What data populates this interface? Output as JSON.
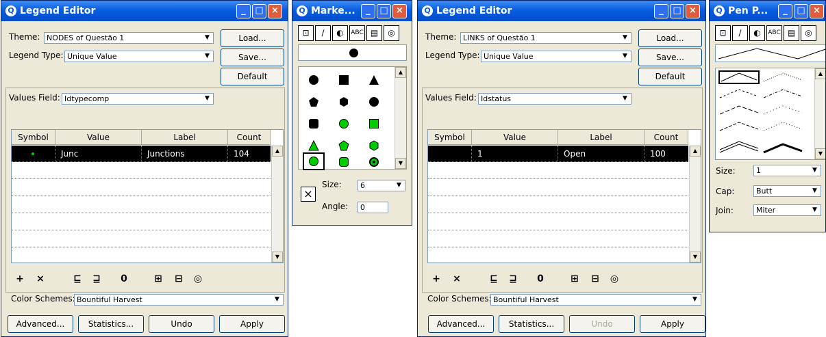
{
  "editor1": {
    "title": "Legend Editor",
    "theme_label": "Theme:",
    "theme_value": "NODES of Questão 1",
    "legend_type_label": "Legend Type:",
    "legend_type_value": "Unique Value",
    "values_field_label": "Values Field:",
    "values_field_value": "Idtypecomp",
    "btn_load": "Load...",
    "btn_save": "Save...",
    "btn_default": "Default",
    "columns": [
      "Symbol",
      "Value",
      "Label",
      "Count"
    ],
    "rows": [
      {
        "value": "Junc",
        "label": "Junctions",
        "count": "104"
      }
    ],
    "color_schemes_label": "Color Schemes:",
    "color_schemes_value": "Bountiful Harvest",
    "btn_advanced": "Advanced...",
    "btn_statistics": "Statistics...",
    "btn_undo": "Undo",
    "btn_apply": "Apply"
  },
  "marker": {
    "title": "Marke...",
    "size_label": "Size:",
    "size_value": "6",
    "angle_label": "Angle:",
    "angle_value": "0",
    "accent": "#00cc00"
  },
  "editor2": {
    "title": "Legend Editor",
    "theme_label": "Theme:",
    "theme_value": "LINKS of Questão 1",
    "legend_type_label": "Legend Type:",
    "legend_type_value": "Unique Value",
    "values_field_label": "Values Field:",
    "values_field_value": "Idstatus",
    "btn_load": "Load...",
    "btn_save": "Save...",
    "btn_default": "Default",
    "columns": [
      "Symbol",
      "Value",
      "Label",
      "Count"
    ],
    "rows": [
      {
        "value": "1",
        "label": "Open",
        "count": "100"
      }
    ],
    "color_schemes_label": "Color Schemes:",
    "color_schemes_value": "Bountiful Harvest",
    "btn_advanced": "Advanced...",
    "btn_statistics": "Statistics...",
    "btn_undo": "Undo",
    "btn_apply": "Apply"
  },
  "pen": {
    "title": "Pen P...",
    "size_label": "Size:",
    "size_value": "1",
    "cap_label": "Cap:",
    "cap_value": "Butt",
    "join_label": "Join:",
    "join_value": "Miter"
  },
  "toolbar": {
    "icons": [
      "add-icon",
      "delete-icon",
      "sort-ascending-icon",
      "sort-descending-icon",
      "zero-icon",
      "properties-icon",
      "color-ramp-icon",
      "palette-icon"
    ]
  }
}
